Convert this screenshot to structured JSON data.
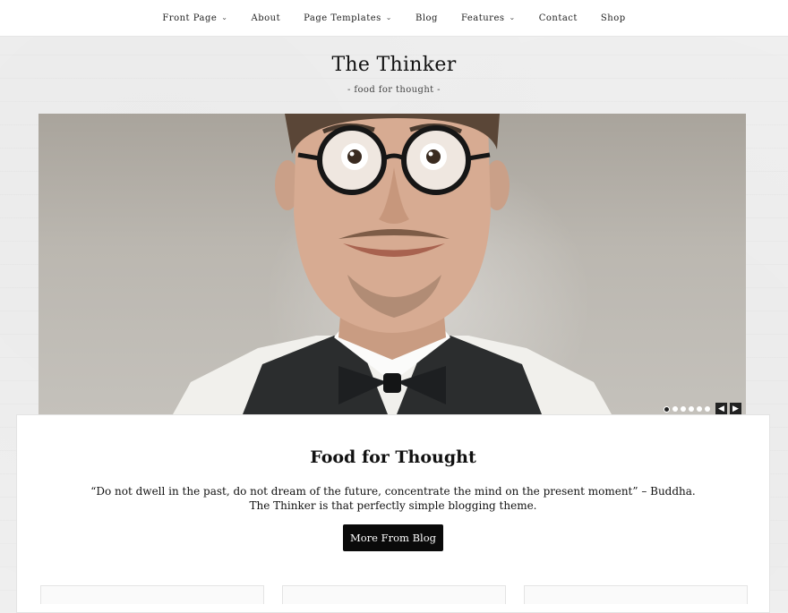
{
  "nav": {
    "items": [
      {
        "label": "Front Page",
        "has_dropdown": true
      },
      {
        "label": "About",
        "has_dropdown": false
      },
      {
        "label": "Page Templates",
        "has_dropdown": true
      },
      {
        "label": "Blog",
        "has_dropdown": false
      },
      {
        "label": "Features",
        "has_dropdown": true
      },
      {
        "label": "Contact",
        "has_dropdown": false
      },
      {
        "label": "Shop",
        "has_dropdown": false
      }
    ],
    "dropdown_icon": "chevron-down-icon"
  },
  "site": {
    "title": "The Thinker",
    "tagline": "- food for thought -"
  },
  "slider": {
    "image": "smiling-man-with-glasses-and-bow-tie",
    "dot_count": 6,
    "active_dot": 0,
    "prev_icon": "chevron-left-icon",
    "next_icon": "chevron-right-icon"
  },
  "content": {
    "title": "Food for Thought",
    "quote_line1": "“Do not dwell in the past, do not dream of the future, concentrate the mind on the present moment” – Buddha.",
    "quote_line2": "The Thinker is that perfectly simple blogging theme.",
    "button_label": "More From Blog"
  },
  "colors": {
    "page_bg": "#efefef",
    "button_bg": "#0a0a0a",
    "button_text": "#ffffff"
  }
}
